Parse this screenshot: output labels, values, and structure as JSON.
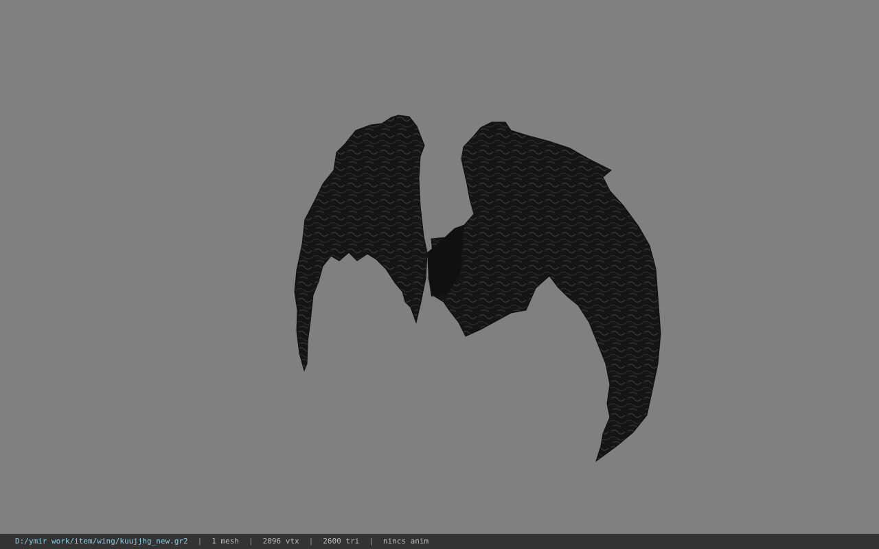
{
  "viewer": {
    "background_color": "#808080",
    "model_color": "#141414",
    "model_name": "wing-model"
  },
  "status": {
    "file_path": "D:/ymir work/item/wing/kuujjhg_new.gr2",
    "mesh_count": "1 mesh",
    "vertex_count": "2096 vtx",
    "triangle_count": "2600 tri",
    "anim_status": "nincs anim",
    "separator": "|",
    "path_color": "#8fd0e6"
  }
}
